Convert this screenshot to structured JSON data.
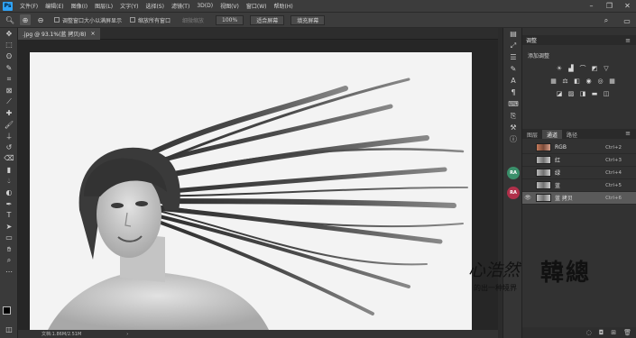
{
  "menubar": {
    "app_logo": "Ps",
    "items": [
      "文件(F)",
      "编辑(E)",
      "图像(I)",
      "图层(L)",
      "文字(Y)",
      "选择(S)",
      "滤镜(T)",
      "3D(D)",
      "视图(V)",
      "窗口(W)",
      "帮助(H)"
    ],
    "window_controls": [
      "minimize-icon",
      "restore-icon",
      "close-icon"
    ]
  },
  "options": {
    "resize_windows_label": "调整窗口大小以满屏显示",
    "zoom_all_label": "缩放所有窗口",
    "scrubby_zoom_label": "细微缩放",
    "zoom_percent": "100%",
    "fit_screen": "适合屏幕",
    "fill_screen": "填充屏幕"
  },
  "document": {
    "tab_title": ".jpg @ 93.1%(蓝 拷贝/8)",
    "tab_close": "×",
    "status_text": "文档:1.86M/2.51M",
    "status_arrow": "›"
  },
  "adjustments": {
    "tab": "调整",
    "subtitle": "添加调整",
    "menu": "≡"
  },
  "layers_tabs": [
    "图层",
    "通道",
    "路径"
  ],
  "active_tab_index": 1,
  "channels": [
    {
      "name": "RGB",
      "shortcut": "Ctrl+2",
      "visible": false,
      "selected": false
    },
    {
      "name": "红",
      "shortcut": "Ctrl+3",
      "visible": false,
      "selected": false
    },
    {
      "name": "绿",
      "shortcut": "Ctrl+4",
      "visible": false,
      "selected": false
    },
    {
      "name": "蓝",
      "shortcut": "Ctrl+5",
      "visible": false,
      "selected": false
    },
    {
      "name": "蓝 拷贝",
      "shortcut": "Ctrl+6",
      "visible": true,
      "selected": true
    }
  ],
  "side_badges": [
    "RA",
    "RA"
  ],
  "watermark": {
    "left": "心浩然",
    "big": "韓總",
    "small": "的出一种境界"
  },
  "colors": {
    "foreground": "#000000",
    "background": "#ffffff",
    "badge_1": "#3a8f6a",
    "badge_2": "#b0304a"
  }
}
